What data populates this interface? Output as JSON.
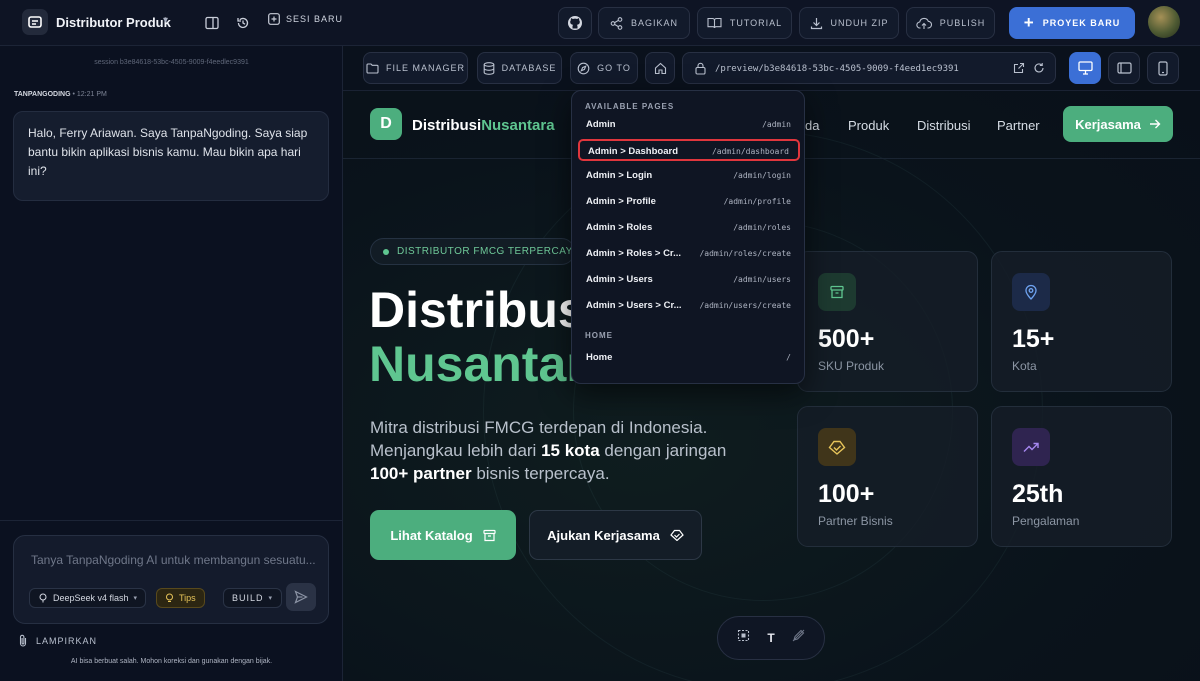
{
  "topbar": {
    "project_title": "Distributor Produk",
    "new_session_label": "SESI BARU",
    "share_label": "BAGIKAN",
    "tutorial_label": "TUTORIAL",
    "download_label": "UNDUH ZIP",
    "publish_label": "PUBLISH",
    "new_project_label": "PROYEK BARU"
  },
  "chat": {
    "session_id": "session b3e84618-53bc-4505-9009-f4eedlec9391",
    "author": "TANPANGODING",
    "time": "• 12:21 PM",
    "message": "Halo, Ferry Ariawan. Saya TanpaNgoding. Saya siap bantu bikin aplikasi bisnis kamu. Mau bikin apa hari ini?",
    "input_placeholder": "Tanya TanpaNgoding AI untuk membangun sesuatu...",
    "model_label": "DeepSeek v4 flash",
    "tips_label": "Tips",
    "mode_label": "BUILD",
    "attach_label": "LAMPIRKAN",
    "disclaimer": "AI bisa berbuat salah. Mohon koreksi dan gunakan dengan bijak."
  },
  "preview_toolbar": {
    "file_manager_label": "FILE MANAGER",
    "database_label": "DATABASE",
    "goto_label": "GO TO",
    "url": "/preview/b3e84618-53bc-4505-9009-f4eed1ec9391"
  },
  "dropdown": {
    "section_available": "AVAILABLE PAGES",
    "section_home": "HOME",
    "items": [
      {
        "name": "Admin",
        "path": "/admin"
      },
      {
        "name": "Admin > Dashboard",
        "path": "/admin/dashboard"
      },
      {
        "name": "Admin > Login",
        "path": "/admin/login"
      },
      {
        "name": "Admin > Profile",
        "path": "/admin/profile"
      },
      {
        "name": "Admin > Roles",
        "path": "/admin/roles"
      },
      {
        "name": "Admin > Roles > Cr...",
        "path": "/admin/roles/create"
      },
      {
        "name": "Admin > Users",
        "path": "/admin/users"
      },
      {
        "name": "Admin > Users > Cr...",
        "path": "/admin/users/create"
      }
    ],
    "home": {
      "name": "Home",
      "path": "/"
    },
    "selected_index": 1
  },
  "site": {
    "logo_letter": "D",
    "brand_a": "Distribusi",
    "brand_b": "Nusantara",
    "nav": [
      "da",
      "Produk",
      "Distribusi",
      "Partner"
    ],
    "cta": "Kerjasama",
    "badge": "DISTRIBUTOR FMCG TERPERCAYA",
    "h1": "Distribusi",
    "h2": "Nusantara",
    "para_1": "Mitra distribusi FMCG terdepan di Indonesia. Menjangkau lebih dari ",
    "para_b1": "15 kota",
    "para_2": " dengan jaringan ",
    "para_b2": "100+ partner",
    "para_3": " bisnis terpercaya.",
    "btn_catalog": "Lihat Katalog",
    "btn_partner": "Ajukan Kerjasama",
    "stats": [
      {
        "value": "500+",
        "label": "SKU Produk"
      },
      {
        "value": "15+",
        "label": "Kota"
      },
      {
        "value": "100+",
        "label": "Partner Bisnis"
      },
      {
        "value": "25th",
        "label": "Pengalaman"
      }
    ]
  },
  "colors": {
    "accent": "#3b6fd6",
    "brand_green": "#4cae7e",
    "selection": "#e0363d"
  }
}
